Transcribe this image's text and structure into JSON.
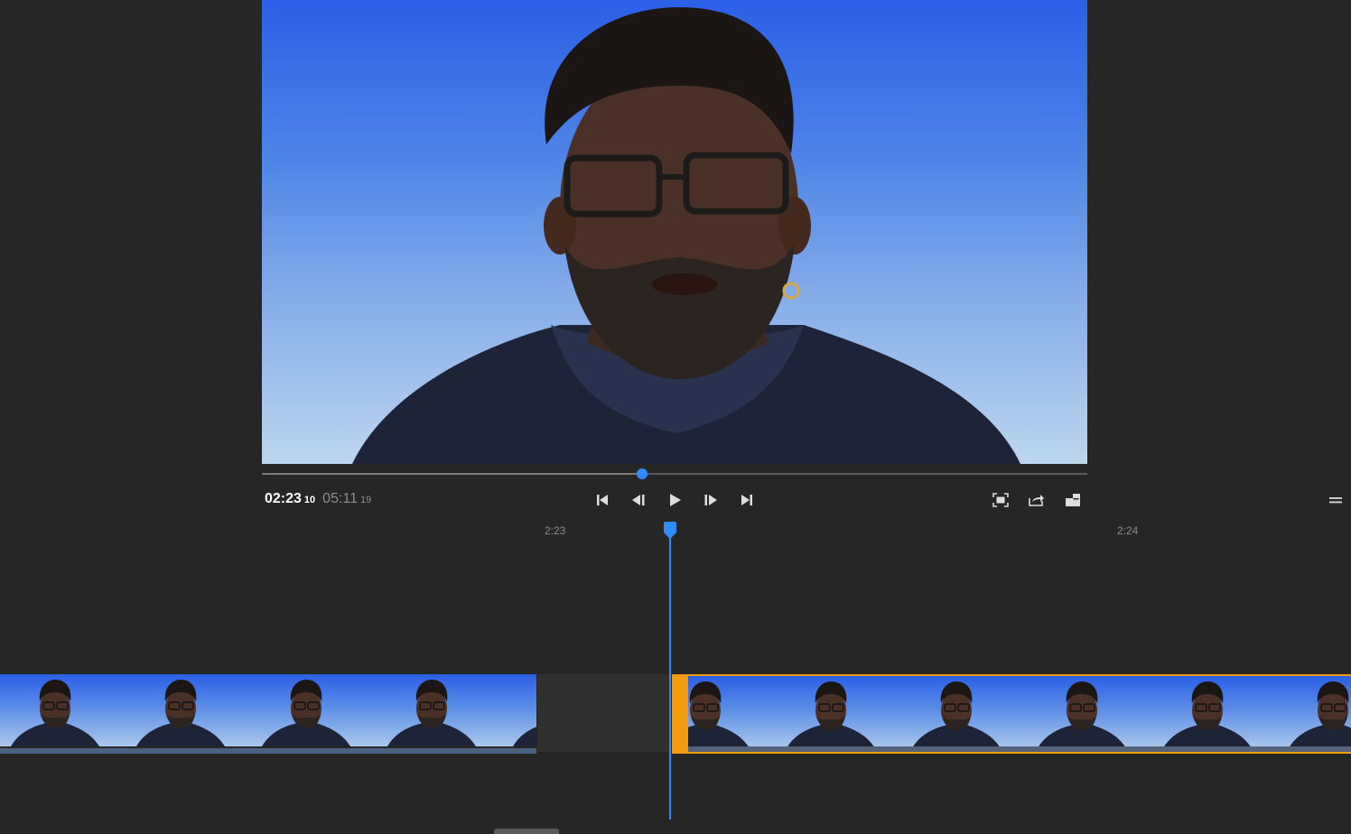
{
  "player": {
    "current_time": "02:23",
    "current_frame": "10",
    "duration": "05:11",
    "duration_frame": "19",
    "progress_fraction": 0.461
  },
  "transport": {
    "icons": [
      "skip-to-start-icon",
      "step-back-icon",
      "play-icon",
      "step-forward-icon",
      "skip-to-end-icon"
    ]
  },
  "view_tools": {
    "icons": [
      "fit-screen-icon",
      "share-icon",
      "resize-icon",
      "menu-icon"
    ]
  },
  "ruler": {
    "labels": [
      "2:23",
      "2:24"
    ]
  },
  "colors": {
    "accent": "#2d8cff",
    "selected_clip": "#f39c12",
    "background": "#262626"
  }
}
